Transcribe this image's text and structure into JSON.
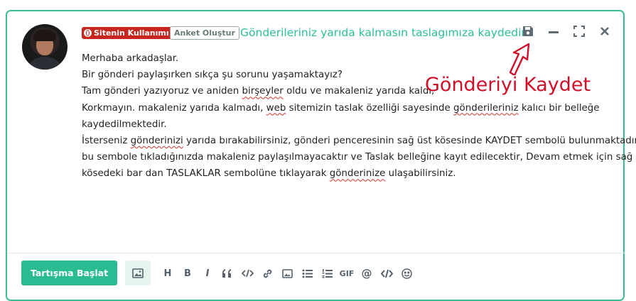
{
  "header": {
    "category_badge": "Sitenin Kullanımı",
    "poll_button": "Anket Oluştur",
    "draft_message": "Gönderileriniz yarıda kalmasın taslagımıza kaydedin"
  },
  "post_body": {
    "line1": "Merhaba arkadaşlar.",
    "line2": "Bir gönderi paylaşırken sıkça şu sorunu yaşamaktayız?",
    "line3_a": "Tam gönderi yazıyoruz ve aniden ",
    "line3_sq": "birşeyler",
    "line3_b": " oldu ve makaleniz yarıda kaldı,",
    "line4_a": "Korkmayın. makaleniz yarıda kalmadı, ",
    "line4_sq1": "web",
    "line4_b": " sitemizin taslak özelliği sayesinde ",
    "line4_sq2": "gönderileriniz",
    "line4_c": " kalıcı bir belleğe",
    "line5": "kaydedilmektedir.",
    "line6_a": "İsterseniz ",
    "line6_sq": "gönderinizi",
    "line6_b": " yarıda bırakabilirsiniz, gönderi penceresinin sağ üst kösesinde KAYDET sembolü bulunmaktadır,",
    "line7": "bu sembole tıkladığınızda makaleniz paylaşılmayacaktır ve Taslak belleğine kayıt edilecektir, Devam etmek için sağ üst",
    "line8_a": "kösedeki bar dan TASLAKLAR sembolüne tıklayarak ",
    "line8_sq": "gönderinize",
    "line8_b": " ulaşabilirsiniz."
  },
  "annotation": {
    "text": "Gönderiyi Kaydet"
  },
  "footer": {
    "submit_label": "Tartışma Başlat",
    "toolbar_glyphs": {
      "heading": "H",
      "bold": "B",
      "italic": "I",
      "gif": "GIF",
      "mention": "@"
    }
  },
  "colors": {
    "accent": "#2bbb93",
    "badge": "#c9251f",
    "annotation": "#d0102a"
  },
  "icons": [
    "save-icon",
    "minimize-icon",
    "fullscreen-icon",
    "close-icon",
    "image-icon",
    "heading-icon",
    "bold-icon",
    "italic-icon",
    "quote-icon",
    "code-icon",
    "link-icon",
    "picture-icon",
    "bullet-list-icon",
    "numbered-list-icon",
    "gif-icon",
    "mention-icon",
    "code-block-icon",
    "emoji-icon"
  ]
}
